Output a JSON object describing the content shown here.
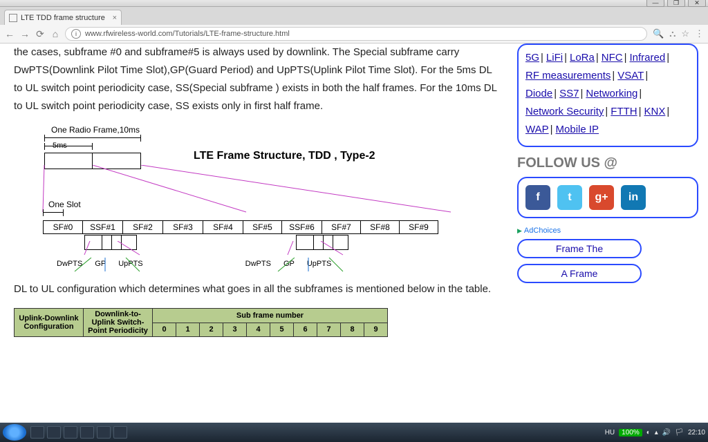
{
  "window_buttons": [
    "—",
    "❐",
    "✕"
  ],
  "tab": {
    "title": "LTE TDD frame structure"
  },
  "addressbar": {
    "url": "www.rfwireless-world.com/Tutorials/LTE-frame-structure.html"
  },
  "article": {
    "p1": "the cases, subframe #0 and subframe#5 is always used by downlink. The Special subframe carry DwPTS(Downlink Pilot Time Slot),GP(Guard Period) and UpPTS(Uplink Pilot Time Slot). For the 5ms DL to UL switch point periodicity case, SS(Special subframe ) exists in both the half frames. For the 10ms DL to UL switch point periodicity case, SS exists only in first half frame.",
    "p2": "DL to UL configuration which determines what goes in all the subframes is mentioned below in the table."
  },
  "diagram": {
    "radio_frame": "One Radio Frame,10ms",
    "half_frame": "5ms",
    "title": "LTE Frame Structure, TDD , Type-2",
    "one_slot": "One Slot",
    "sf": [
      "SF#0",
      "SSF#1",
      "SF#2",
      "SF#3",
      "SF#4",
      "SF#5",
      "SSF#6",
      "SF#7",
      "SF#8",
      "SF#9"
    ],
    "sub_labels": [
      "DwPTS",
      "GP",
      "UpPTS",
      "DwPTS",
      "GP",
      "UpPTS"
    ]
  },
  "gtable": {
    "h1": "Uplink-Downlink Configuration",
    "h2": "Downlink-to-Uplink Switch-Point Periodicity",
    "h3": "Sub frame number",
    "nums": [
      "0",
      "1",
      "2",
      "3",
      "4",
      "5",
      "6",
      "7",
      "8",
      "9"
    ]
  },
  "sidebar": {
    "tags": [
      "5G",
      "LiFi",
      "LoRa",
      "NFC",
      "Infrared",
      "RF measurements",
      "VSAT",
      "Diode",
      "SS7",
      "Networking",
      "Network Security",
      "FTTH",
      "KNX",
      "WAP",
      "Mobile IP"
    ],
    "follow": "FOLLOW US @",
    "adchoices": "AdChoices",
    "ad_buttons": [
      "Frame The",
      "A Frame"
    ]
  },
  "taskbar": {
    "lang": "HU",
    "zoom": "100%",
    "time": "22:10"
  }
}
